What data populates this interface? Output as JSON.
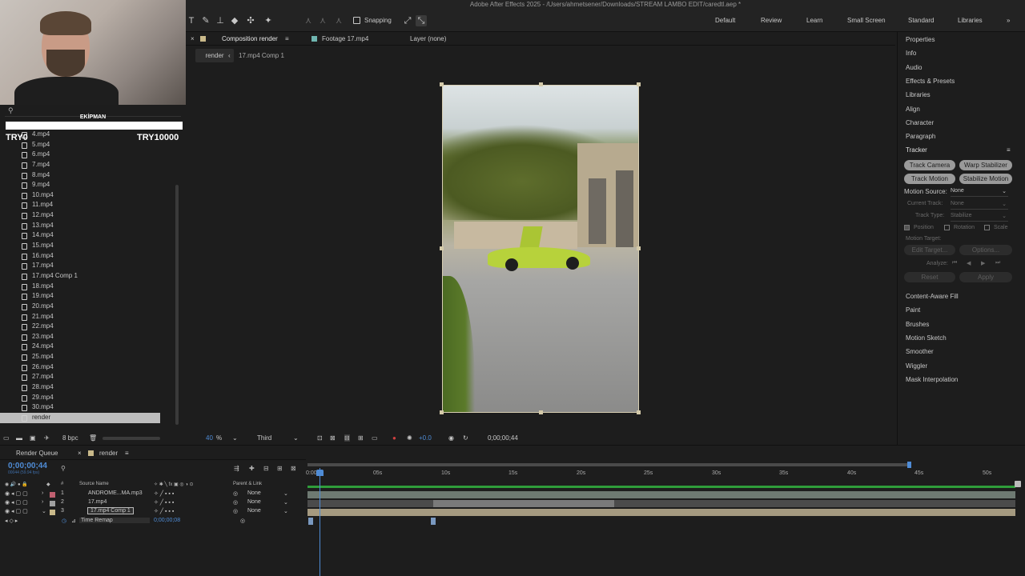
{
  "title": "Adobe After Effects 2025 - /Users/ahmetsener/Downloads/STREAM LAMBO EDIT/caredtl.aep *",
  "toolbar": {
    "snapping_label": "Snapping",
    "workspaces": [
      "Default",
      "Review",
      "Learn",
      "Small Screen",
      "Standard",
      "Libraries"
    ]
  },
  "overlay": {
    "heading": "EKİPMAN",
    "left_value": "TRY0",
    "right_value": "TRY10000"
  },
  "project": {
    "files": [
      "4.mp4",
      "5.mp4",
      "6.mp4",
      "7.mp4",
      "8.mp4",
      "9.mp4",
      "10.mp4",
      "11.mp4",
      "12.mp4",
      "13.mp4",
      "14.mp4",
      "15.mp4",
      "16.mp4",
      "17.mp4",
      "17.mp4 Comp 1",
      "18.mp4",
      "19.mp4",
      "20.mp4",
      "21.mp4",
      "22.mp4",
      "23.mp4",
      "24.mp4",
      "25.mp4",
      "26.mp4",
      "27.mp4",
      "28.mp4",
      "29.mp4",
      "30.mp4",
      "render"
    ],
    "bpc": "8 bpc"
  },
  "comp": {
    "tab_composition": "Composition render",
    "tab_footage": "Footage 17.mp4",
    "tab_layer": "Layer (none)",
    "crumb_current": "render",
    "crumb_next": "17.mp4 Comp 1",
    "zoom": "40",
    "zoom_unit": "%",
    "resolution": "Third",
    "exposure": "+0.0",
    "timecode": "0;00;00;44"
  },
  "right_panel": {
    "items_top": [
      "Properties",
      "Info",
      "Audio",
      "Effects & Presets",
      "Libraries",
      "Align",
      "Character",
      "Paragraph"
    ],
    "tracker_title": "Tracker",
    "track_camera": "Track Camera",
    "warp_stabilizer": "Warp Stabilizer",
    "track_motion": "Track Motion",
    "stabilize_motion": "Stabilize Motion",
    "motion_source_label": "Motion Source:",
    "motion_source_value": "None",
    "current_track_label": "Current Track:",
    "current_track_value": "None",
    "track_type_label": "Track Type:",
    "track_type_value": "Stabilize",
    "position_label": "Position",
    "rotation_label": "Rotation",
    "scale_label": "Scale",
    "motion_target_label": "Motion Target:",
    "edit_target": "Edit Target...",
    "options": "Options...",
    "analyze_label": "Analyze:",
    "reset": "Reset",
    "apply": "Apply",
    "items_bottom": [
      "Content-Aware Fill",
      "Paint",
      "Brushes",
      "Motion Sketch",
      "Smoother",
      "Wiggler",
      "Mask Interpolation"
    ]
  },
  "timeline": {
    "tab_render_queue": "Render Queue",
    "tab_render": "render",
    "timecode": "0;00;00;44",
    "timecode_sub": "00044 (59.94 fps)",
    "col_source": "Source Name",
    "col_parent": "Parent & Link",
    "col_num": "#",
    "layers": [
      {
        "num": "1",
        "name": "ANDROME...MA.mp3",
        "parent": "None",
        "color": "#c06070"
      },
      {
        "num": "2",
        "name": "17.mp4",
        "parent": "None",
        "color": "#a0a0a0"
      },
      {
        "num": "3",
        "name": "17.mp4 Comp 1",
        "parent": "None",
        "color": "#c9b98a"
      }
    ],
    "remap_label": "Time Remap",
    "remap_value": "0;00;00;08",
    "ruler": [
      "0:00s",
      "05s",
      "10s",
      "15s",
      "20s",
      "25s",
      "30s",
      "35s",
      "40s",
      "45s",
      "50s"
    ]
  }
}
